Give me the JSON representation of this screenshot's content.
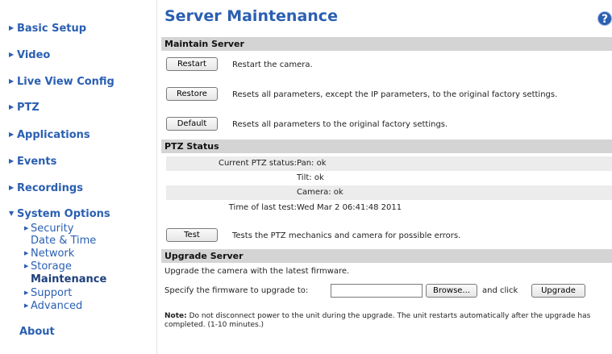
{
  "sidebar": {
    "items": [
      {
        "label": "Basic Setup"
      },
      {
        "label": "Video"
      },
      {
        "label": "Live View Config"
      },
      {
        "label": "PTZ"
      },
      {
        "label": "Applications"
      },
      {
        "label": "Events"
      },
      {
        "label": "Recordings"
      },
      {
        "label": "System Options"
      },
      {
        "label": "About"
      }
    ],
    "sub": [
      {
        "label": "Security"
      },
      {
        "label": "Date & Time"
      },
      {
        "label": "Network"
      },
      {
        "label": "Storage"
      },
      {
        "label": "Maintenance"
      },
      {
        "label": "Support"
      },
      {
        "label": "Advanced"
      }
    ]
  },
  "page": {
    "title": "Server Maintenance",
    "help_icon": "help-icon",
    "help_glyph": "?"
  },
  "maintain": {
    "header": "Maintain Server",
    "restart_label": "Restart",
    "restart_desc": "Restart the camera.",
    "restore_label": "Restore",
    "restore_desc": "Resets all parameters, except the IP parameters, to the original factory settings.",
    "default_label": "Default",
    "default_desc": "Resets all parameters to the original factory settings."
  },
  "ptz": {
    "header": "PTZ Status",
    "current_label": "Current PTZ status:",
    "pan": "Pan: ok",
    "tilt": "Tilt: ok",
    "camera": "Camera: ok",
    "time_label": "Time of last test:",
    "time_value": "Wed Mar 2 06:41:48 2011",
    "test_label": "Test",
    "test_desc": "Tests the PTZ mechanics and camera for possible errors."
  },
  "upgrade": {
    "header": "Upgrade Server",
    "intro": "Upgrade the camera with the latest firmware.",
    "specify": "Specify the firmware to upgrade to:",
    "input_value": "",
    "browse_label": "Browse...",
    "and_click": "and click",
    "upgrade_label": "Upgrade",
    "note_bold": "Note:",
    "note_text": " Do not disconnect power to the unit during the upgrade. The unit restarts automatically after the upgrade has completed. (1-10 minutes.)"
  },
  "colors": {
    "link": "#2a5fb2",
    "section_bg": "#d4d4d4"
  }
}
